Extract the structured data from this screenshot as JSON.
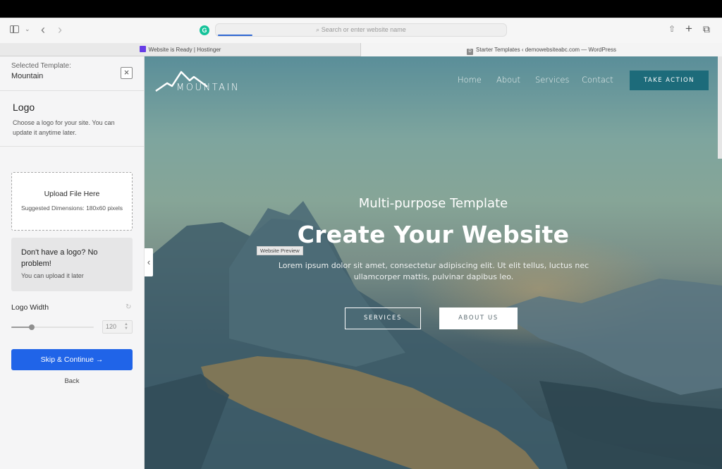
{
  "browser": {
    "url_placeholder": "Search or enter website name",
    "page_load_progress": 0.12,
    "tabs": [
      {
        "label": "Website is Ready | Hostinger",
        "favicon": "hostinger-icon",
        "active": false
      },
      {
        "label": "Starter Templates ‹ demowebsiteabc.com — WordPress",
        "favicon": "wordpress-d-icon",
        "favicon_text": "D",
        "active": true
      }
    ],
    "icons": {
      "sidebar": "sidebar-icon",
      "chevron": "⌄",
      "back": "‹",
      "forward": "›",
      "grammarly": "G",
      "search": "⌕",
      "share": "⇧",
      "new_tab": "+",
      "tabs_overview": "⧉"
    }
  },
  "sidebar": {
    "selected_template_label": "Selected Template:",
    "selected_template_value": "Mountain",
    "close_icon": "×",
    "section_title": "Logo",
    "section_desc": "Choose a logo for your site. You can update it anytime later.",
    "upload": {
      "title": "Upload File Here",
      "hint": "Suggested Dimensions: 180x60 pixels"
    },
    "no_logo": {
      "heading": "Don't have a logo? No problem!",
      "subtext": "You can upload it later"
    },
    "logo_width": {
      "label": "Logo Width",
      "reset_icon": "↻",
      "value": "120",
      "slider_fraction": 0.25,
      "spin_up": "▲",
      "spin_down": "▼"
    },
    "primary_button": "Skip & Continue  →",
    "back_link": "Back",
    "collapse_icon": "‹"
  },
  "preview": {
    "tooltip": "Website Preview",
    "site": {
      "logo_text": "MOUNTAIN",
      "nav": [
        "Home",
        "About",
        "Services",
        "Contact"
      ],
      "cta": "TAKE ACTION",
      "hero_subtitle": "Multi-purpose Template",
      "hero_title": "Create Your Website",
      "hero_text": "Lorem ipsum dolor sit amet, consectetur adipiscing elit. Ut elit tellus, luctus nec ullamcorper mattis, pulvinar dapibus leo.",
      "button_outline": "SERVICES",
      "button_solid": "ABOUT US"
    },
    "colors": {
      "cta_bg": "#1d6b7a",
      "primary_blue": "#2064e8"
    }
  }
}
